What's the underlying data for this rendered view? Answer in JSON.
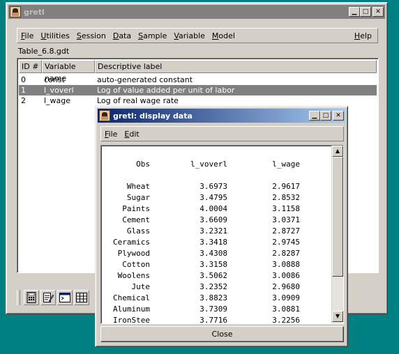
{
  "main_window": {
    "title": "gretl",
    "menu": [
      {
        "label": "File",
        "key": "F",
        "rest": "ile"
      },
      {
        "label": "Utilities",
        "key": "U",
        "rest": "tilities"
      },
      {
        "label": "Session",
        "key": "S",
        "rest": "ession"
      },
      {
        "label": "Data",
        "key": "D",
        "rest": "ata"
      },
      {
        "label": "Sample",
        "key": "S",
        "rest": "ample"
      },
      {
        "label": "Variable",
        "key": "V",
        "rest": "ariable"
      },
      {
        "label": "Model",
        "key": "M",
        "rest": "odel"
      }
    ],
    "help_menu": {
      "label": "Help",
      "key": "H",
      "rest": "elp"
    },
    "dataset_name": "Table_6.8.gdt",
    "columns": {
      "id": "ID #",
      "name": "Variable name",
      "label": "Descriptive label"
    },
    "variables": [
      {
        "id": "0",
        "name": "const",
        "label": "auto-generated constant"
      },
      {
        "id": "1",
        "name": "l_voverl",
        "label": "Log of value added per unit of labor"
      },
      {
        "id": "2",
        "name": "l_wage",
        "label": "Log of real wage rate"
      }
    ],
    "selected_row": 1,
    "toolbar_icons": [
      "calculator-icon",
      "notepad-icon",
      "terminal-icon",
      "grid-icon"
    ]
  },
  "data_window": {
    "title": "gretl: display data",
    "menu": [
      {
        "label": "File",
        "key": "F",
        "rest": "ile"
      },
      {
        "label": "Edit",
        "key": "E",
        "rest": "dit"
      }
    ],
    "headers": {
      "obs": "Obs",
      "col1": "l_voverl",
      "col2": "l_wage"
    },
    "rows": [
      {
        "obs": "Wheat",
        "v1": "3.6973",
        "v2": "2.9617"
      },
      {
        "obs": "Sugar",
        "v1": "3.4795",
        "v2": "2.8532"
      },
      {
        "obs": "Paints",
        "v1": "4.0004",
        "v2": "3.1158"
      },
      {
        "obs": "Cement",
        "v1": "3.6609",
        "v2": "3.0371"
      },
      {
        "obs": "Glass",
        "v1": "3.2321",
        "v2": "2.8727"
      },
      {
        "obs": "Ceramics",
        "v1": "3.3418",
        "v2": "2.9745"
      },
      {
        "obs": "Plywood",
        "v1": "3.4308",
        "v2": "2.8287"
      },
      {
        "obs": "Cotton",
        "v1": "3.3158",
        "v2": "3.0888"
      },
      {
        "obs": "Woolens",
        "v1": "3.5062",
        "v2": "3.0086"
      },
      {
        "obs": "Jute",
        "v1": "3.2352",
        "v2": "2.9680"
      },
      {
        "obs": "Chemical",
        "v1": "3.8823",
        "v2": "3.0909"
      },
      {
        "obs": "Aluminum",
        "v1": "3.7309",
        "v2": "3.0881"
      },
      {
        "obs": "IronStee",
        "v1": "3.7716",
        "v2": "3.2256"
      }
    ],
    "close_label": "Close"
  }
}
